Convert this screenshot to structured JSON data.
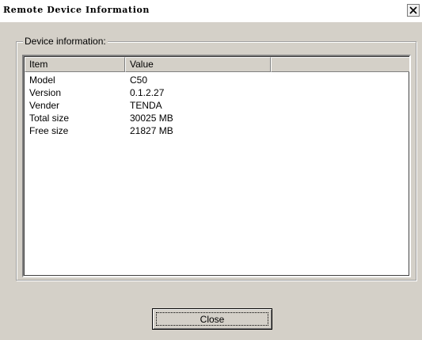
{
  "window": {
    "title": "Remote Device Information",
    "close_glyph": "×",
    "close_icon": "close-icon"
  },
  "group": {
    "label": "Device information:"
  },
  "table": {
    "columns": [
      "Item",
      "Value",
      ""
    ],
    "rows": [
      {
        "item": "Model",
        "value": "C50"
      },
      {
        "item": "Version",
        "value": "0.1.2.27"
      },
      {
        "item": "Vender",
        "value": "TENDA"
      },
      {
        "item": "Total size",
        "value": "30025 MB"
      },
      {
        "item": "Free size",
        "value": "21827 MB"
      }
    ]
  },
  "buttons": {
    "close_label": "Close"
  },
  "colors": {
    "dialog_bg": "#d4d0c8",
    "list_bg": "#ffffff"
  }
}
